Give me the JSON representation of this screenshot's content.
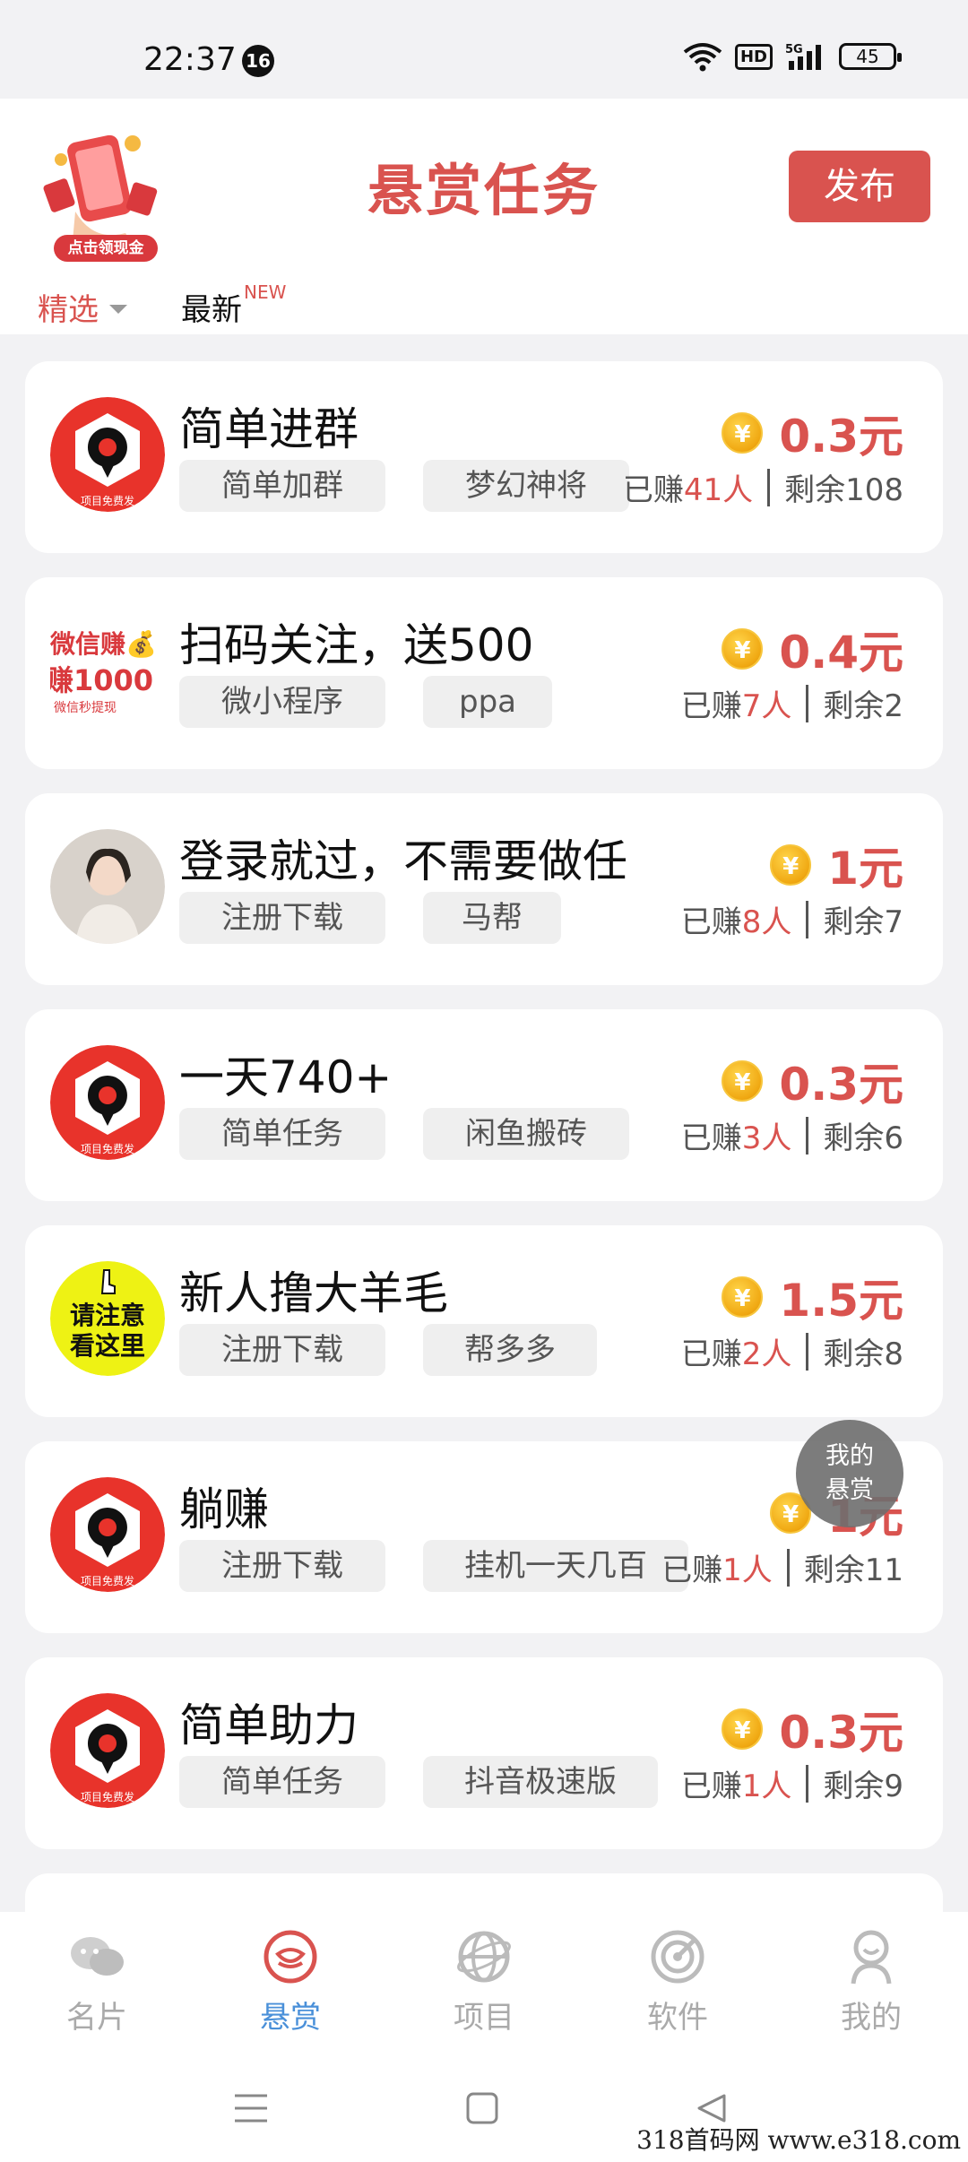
{
  "status_bar": {
    "time": "22:37",
    "notification_count": "16",
    "network": "5G",
    "hd": "HD",
    "battery": "45"
  },
  "header": {
    "promo_label": "点击领现金",
    "title": "悬赏任务",
    "publish_label": "发布",
    "filter_selected": "精选",
    "filter_latest": "最新",
    "new_badge": "NEW"
  },
  "tasks": [
    {
      "title": "简单进群",
      "tag1": "简单加群",
      "tag2": "梦幻神将",
      "coin": "¥",
      "amount": "0.3元",
      "earned_prefix": "已赚",
      "earned": "41人",
      "remaining": "剩余108",
      "avatar": "red-logo-icon",
      "avatar_text": "项目免费发"
    },
    {
      "title": "扫码关注，送500",
      "tag1": "微小程序",
      "tag2": "ppa",
      "coin": "¥",
      "amount": "0.4元",
      "earned_prefix": "已赚",
      "earned": "7人",
      "remaining": "剩余2",
      "avatar": "wechat-promo-icon",
      "avatar_line1": "微信赚💰",
      "avatar_line2": "赚1000",
      "avatar_line3": "微信秒提现"
    },
    {
      "title": "登录就过，不需要做任",
      "tag1": "注册下载",
      "tag2": "马帮",
      "coin": "¥",
      "amount": "1元",
      "earned_prefix": "已赚",
      "earned": "8人",
      "remaining": "剩余7",
      "avatar": "photo-avatar-icon"
    },
    {
      "title": "一天740+",
      "tag1": "简单任务",
      "tag2": "闲鱼搬砖",
      "coin": "¥",
      "amount": "0.3元",
      "earned_prefix": "已赚",
      "earned": "3人",
      "remaining": "剩余6",
      "avatar": "red-logo-icon",
      "avatar_text": "项目免费发"
    },
    {
      "title": "新人撸大羊毛",
      "tag1": "注册下载",
      "tag2": "帮多多",
      "coin": "¥",
      "amount": "1.5元",
      "earned_prefix": "已赚",
      "earned": "2人",
      "remaining": "剩余8",
      "avatar": "notice-badge-icon",
      "avatar_line1": "请注意",
      "avatar_line2": "看这里"
    },
    {
      "title": "躺赚",
      "tag1": "注册下载",
      "tag2": "挂机一天几百",
      "coin": "¥",
      "amount": "1元",
      "earned_prefix": "已赚",
      "earned": "1人",
      "remaining": "剩余11",
      "avatar": "red-logo-icon",
      "avatar_text": "项目免费发"
    },
    {
      "title": "简单助力",
      "tag1": "简单任务",
      "tag2": "抖音极速版",
      "coin": "¥",
      "amount": "0.3元",
      "earned_prefix": "已赚",
      "earned": "1人",
      "remaining": "剩余9",
      "avatar": "red-logo-icon",
      "avatar_text": "项目免费发"
    }
  ],
  "float_button": {
    "line1": "我的",
    "line2": "悬赏"
  },
  "nav": [
    {
      "label": "名片",
      "icon": "chat-bubbles-icon"
    },
    {
      "label": "悬赏",
      "icon": "reward-icon"
    },
    {
      "label": "项目",
      "icon": "globe-icon"
    },
    {
      "label": "软件",
      "icon": "radar-icon"
    },
    {
      "label": "我的",
      "icon": "person-icon"
    }
  ],
  "watermark": "318首码网  www.e318.com",
  "colors": {
    "accent": "#d9534f",
    "nav_active": "#4a90d9",
    "coin": "#f0a812"
  }
}
